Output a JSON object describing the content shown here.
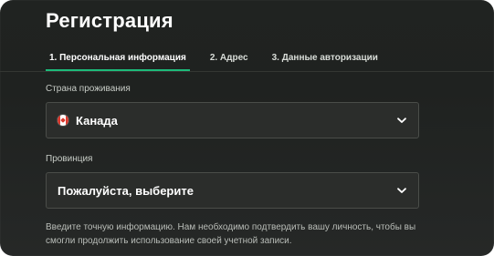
{
  "dialog": {
    "title": "Регистрация"
  },
  "tabs": [
    {
      "label": "1. Персональная информация",
      "active": true
    },
    {
      "label": "2. Адрес",
      "active": false
    },
    {
      "label": "3. Данные авторизации",
      "active": false
    }
  ],
  "form": {
    "country": {
      "label": "Страна проживания",
      "value": "Канада",
      "flag_icon": "canada-flag-icon"
    },
    "province": {
      "label": "Провинция",
      "value": "Пожалуйста, выберите"
    },
    "hint": "Введите точную информацию. Нам необходимо подтвердить вашу личность, чтобы вы смогли продолжить использование своей учетной записи."
  },
  "colors": {
    "accent": "#1dbb7a",
    "background": "#202321",
    "field_border": "#4a4d49",
    "field_background": "#2b2d2b",
    "text_primary": "#ffffff",
    "text_secondary": "#c7ccc6"
  }
}
